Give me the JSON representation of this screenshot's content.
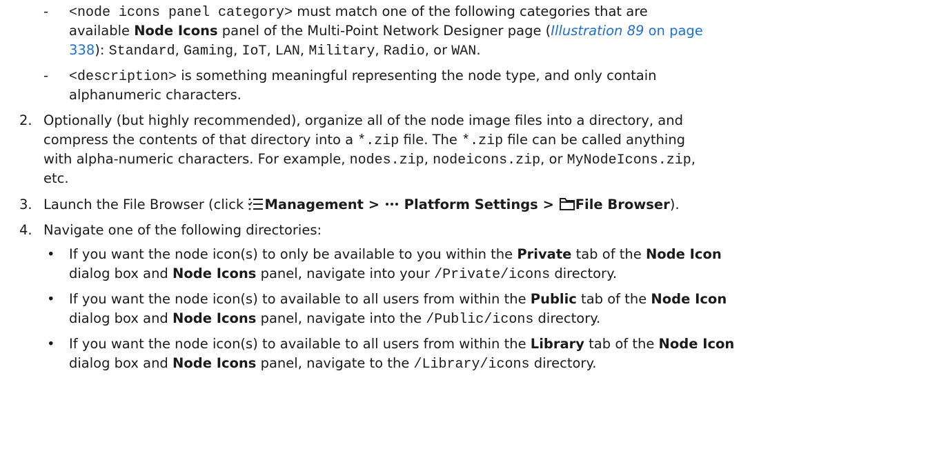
{
  "sub_a": {
    "dash": "-",
    "l1_mono": "<node icons panel category>",
    "l1_text": " must match one of the following categories that are",
    "l2_a": "available ",
    "l2_b": "Node Icons",
    "l2_c": " panel of the Multi-Point Network Designer page (",
    "l2_ill": "Illustration 89",
    "l2_on": " on page",
    "l3_page": "338",
    "l3_a": "): ",
    "cats": [
      "Standard",
      "Gaming",
      "IoT",
      "LAN",
      "Military",
      "Radio"
    ],
    "l3_or": ", or ",
    "l3_last": "WAN",
    "l3_end": "."
  },
  "sub_b": {
    "dash": "-",
    "l1_mono": "<description>",
    "l1_text": " is something meaningful representing the node type, and only contain",
    "l2": "alphanumeric characters."
  },
  "step2": {
    "num": "2.",
    "l1": "Optionally (but highly recommended), organize all of the node image files into a directory, and",
    "l2_a": "compress the contents of that directory into a ",
    "l2_zip": "*.zip",
    "l2_b": " file. The ",
    "l2_zip2": "*.zip",
    "l2_c": " file can be called anything",
    "l3_a": "with alpha-numeric characters. For example, ",
    "ex1": "nodes.zip",
    "sep1": ", ",
    "ex2": "nodeicons.zip",
    "sep2": ", or ",
    "ex3": "MyNodeIcons.zip",
    "l3_end": ",",
    "l4": "etc."
  },
  "step3": {
    "num": "3.",
    "a": "Launch the File Browser (click ",
    "mgmt": "Management > ",
    "plat": " Platform Settings > ",
    "fb": "File Browser",
    "end": ")."
  },
  "step4": {
    "num": "4.",
    "text": "Navigate one of the following directories:",
    "bullets": [
      {
        "l1_a": "If you want the node icon(s) to only be available to you within the ",
        "tab": "Private",
        "l1_b": " tab of the ",
        "dlg": "Node Icon",
        "l2_a": "dialog box and ",
        "panel": "Node Icons",
        "l2_b": " panel, navigate into your ",
        "path": "/Private/icons",
        "l2_c": " directory."
      },
      {
        "l1_a": "If you want the node icon(s) to available to all users from within the ",
        "tab": "Public",
        "l1_b": " tab of the ",
        "dlg": "Node Icon",
        "l2_a": "dialog box and ",
        "panel": "Node Icons",
        "l2_b": " panel, navigate into the ",
        "path": "/Public/icons",
        "l2_c": " directory."
      },
      {
        "l1_a": "If you want the node icon(s) to available to all users from within the ",
        "tab": "Library",
        "l1_b": " tab of the ",
        "dlg": "Node Icon",
        "l2_a": "dialog box and ",
        "panel": "Node Icons",
        "l2_b": " panel, navigate to the ",
        "path": "/Library/icons",
        "l2_c": " directory."
      }
    ]
  },
  "icons": {
    "management": "management-list-icon",
    "platform": "more-dots-icon",
    "file_browser": "folder-icon"
  }
}
